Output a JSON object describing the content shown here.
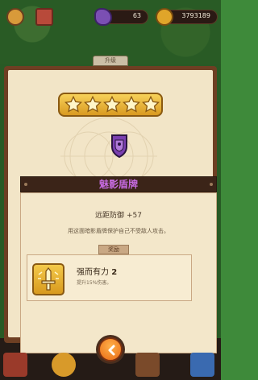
{
  "resources": {
    "gems": "63",
    "coins": "3793189"
  },
  "tab": {
    "label": "升级"
  },
  "item": {
    "stars": 5,
    "name": "魅影盾牌",
    "stat_label": "远距防御",
    "stat_value": "+57",
    "description": "用这面暗影盾牌保护自己不受敌人攻击。"
  },
  "reward": {
    "tag": "奖励",
    "name": "强而有力",
    "level": "2",
    "description": "提升15%伤害。"
  },
  "colors": {
    "panel": "#6e3f23",
    "parchment": "#f2e5c7",
    "title_text": "#c56adf",
    "star_gold": "#f7c52a",
    "back_button": "#f08a1e"
  }
}
